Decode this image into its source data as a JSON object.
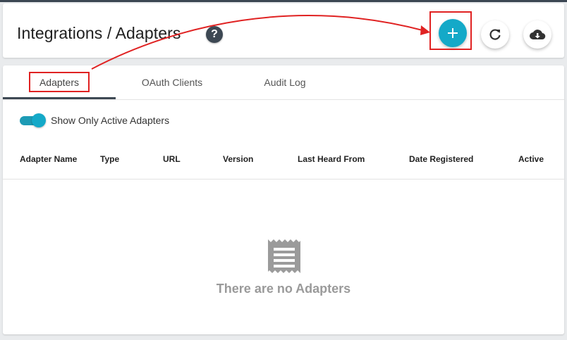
{
  "header": {
    "title": "Integrations / Adapters",
    "help_icon": "question-circle-icon",
    "help_glyph": "?",
    "actions": [
      {
        "name": "add",
        "icon": "plus-icon",
        "color": "#14a9c8"
      },
      {
        "name": "refresh",
        "icon": "refresh-icon",
        "color": "#ffffff"
      },
      {
        "name": "download",
        "icon": "cloud-download-icon",
        "color": "#ffffff"
      }
    ]
  },
  "tabs": [
    {
      "label": "Adapters",
      "active": true
    },
    {
      "label": "OAuth Clients",
      "active": false
    },
    {
      "label": "Audit Log",
      "active": false
    }
  ],
  "filter": {
    "toggle_label": "Show Only Active Adapters",
    "toggle_on": true
  },
  "table": {
    "columns": [
      "Adapter Name",
      "Type",
      "URL",
      "Version",
      "Last Heard From",
      "Date Registered",
      "Active"
    ],
    "rows": []
  },
  "empty_state": {
    "icon": "receipt-icon",
    "message": "There are no Adapters"
  },
  "colors": {
    "accent": "#14a9c8",
    "annotation": "#e02222",
    "dark": "#3d4853"
  }
}
